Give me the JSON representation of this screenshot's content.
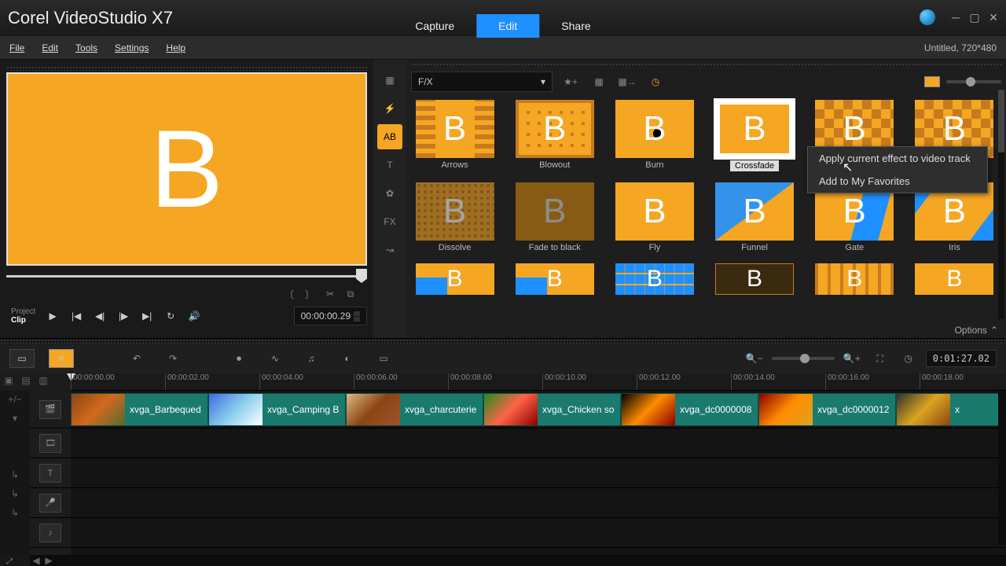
{
  "app": {
    "title": "Corel VideoStudio X7"
  },
  "modes": {
    "capture": "Capture",
    "edit": "Edit",
    "share": "Share",
    "active": "edit"
  },
  "menu": {
    "file": "File",
    "edit": "Edit",
    "tools": "Tools",
    "settings": "Settings",
    "help": "Help"
  },
  "project": {
    "name": "Untitled",
    "resolution": "720*480",
    "display": "Untitled, 720*480"
  },
  "preview": {
    "letter": "B",
    "mode_project": "Project",
    "mode_clip": "Clip",
    "timecode": "00:00:00.29"
  },
  "library": {
    "category": "F/X",
    "options_label": "Options",
    "transitions": [
      {
        "name": "Arrows",
        "ov": "ov-arrows"
      },
      {
        "name": "Blowout",
        "ov": "ov-blowout"
      },
      {
        "name": "Burn",
        "ov": "ov-burn"
      },
      {
        "name": "Crossfade",
        "ov": "",
        "selected": true
      },
      {
        "name": "",
        "ov": "ov-checker"
      },
      {
        "name": "",
        "ov": "ov-checker"
      },
      {
        "name": "Dissolve",
        "ov": "ov-dissolve"
      },
      {
        "name": "Fade to black",
        "ov": "ov-fade"
      },
      {
        "name": "Fly",
        "ov": ""
      },
      {
        "name": "Funnel",
        "ov": "ov-funnel"
      },
      {
        "name": "Gate",
        "ov": "ov-gate"
      },
      {
        "name": "Iris",
        "ov": "ov-iris"
      }
    ],
    "row3": [
      {
        "ov": "ov-blue-l"
      },
      {
        "ov": "ov-blue-l"
      },
      {
        "ov": "ov-pixel"
      },
      {
        "ov": "ov-dark"
      },
      {
        "ov": "ov-stripe"
      },
      {
        "ov": ""
      }
    ]
  },
  "context_menu": {
    "apply": "Apply current effect to video track",
    "favorite": "Add to My Favorites"
  },
  "timeline": {
    "total": "0:01:27.02",
    "ticks": [
      "00:00:00.00",
      "00:00:02.00",
      "00:00:04.00",
      "00:00:06.00",
      "00:00:08.00",
      "00:00:10.00",
      "00:00:12.00",
      "00:00:14.00",
      "00:00:16.00",
      "00:00:18.00"
    ],
    "clips": [
      {
        "label": "xvga_Barbequed",
        "thumb": "t1"
      },
      {
        "label": "xvga_Camping B",
        "thumb": "t2"
      },
      {
        "label": "xvga_charcuterie",
        "thumb": "t4"
      },
      {
        "label": "xvga_Chicken so",
        "thumb": "t5"
      },
      {
        "label": "xvga_dc0000008",
        "thumb": "t6"
      },
      {
        "label": "xvga_dc0000012",
        "thumb": "t7"
      },
      {
        "label": "x",
        "thumb": "t8"
      }
    ]
  }
}
